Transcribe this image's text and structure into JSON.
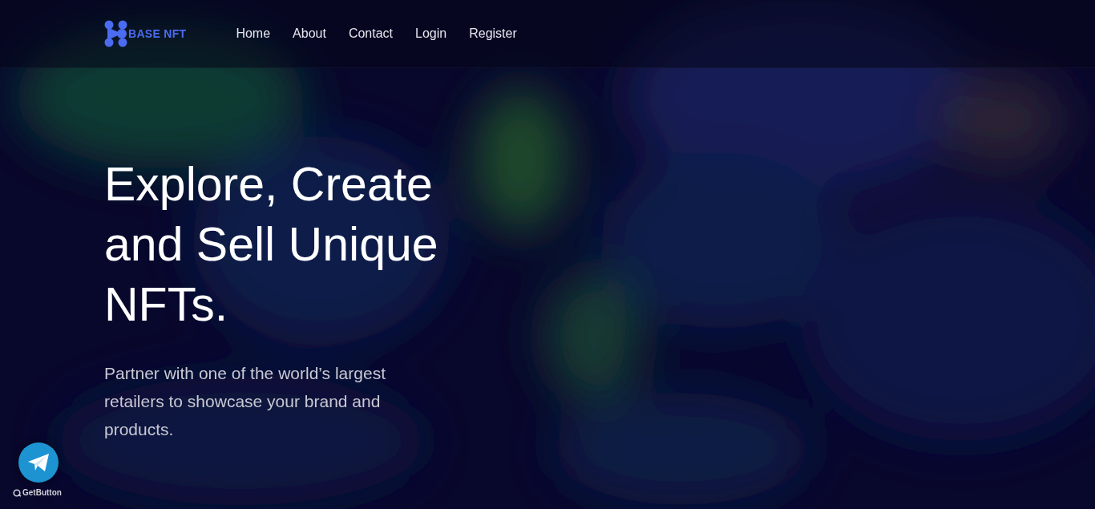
{
  "brand": {
    "name": "BASE NFT"
  },
  "nav": [
    {
      "label": "Home"
    },
    {
      "label": "About"
    },
    {
      "label": "Contact"
    },
    {
      "label": "Login"
    },
    {
      "label": "Register"
    }
  ],
  "hero": {
    "title": "Explore, Create and Sell Unique NFTs.",
    "subtitle": "Partner with one of the world’s largest retailers to showcase your brand and products."
  },
  "widget": {
    "label": "GetButton"
  }
}
